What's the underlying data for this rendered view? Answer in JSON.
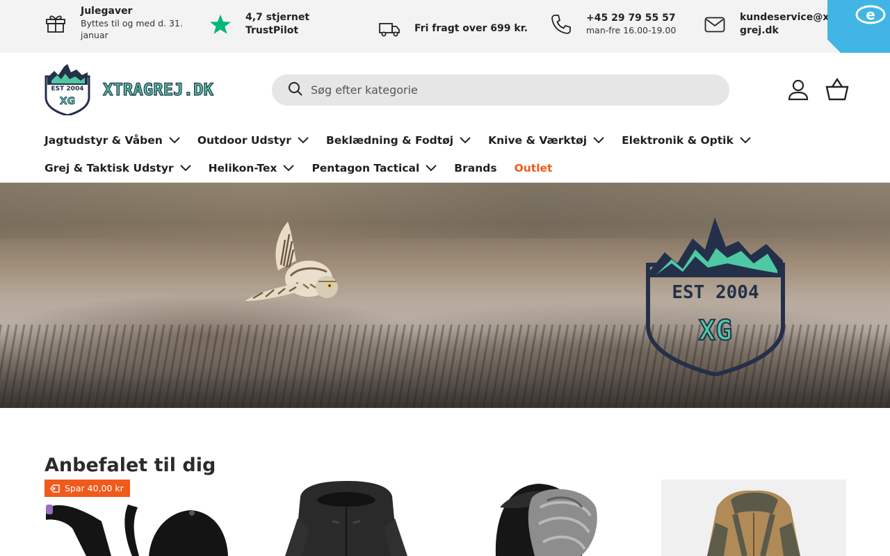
{
  "infobar": {
    "gifts": {
      "title": "Julegaver",
      "subtitle": "Byttes til og med d. 31. januar",
      "icon": "gift-icon"
    },
    "rating": {
      "title": "4,7 stjernet TrustPilot",
      "icon": "star-icon",
      "color": "#00b67a"
    },
    "shipping": {
      "title": "Fri fragt over 699 kr.",
      "icon": "truck-icon"
    },
    "phone": {
      "title": "+45 29 79 55 57",
      "subtitle": "man-fre 16.00-19.00",
      "icon": "phone-icon"
    },
    "email": {
      "title": "kundeservice@xtragrej.dk",
      "icon": "mail-icon"
    },
    "corner_badge": {
      "icon": "e-mark-icon",
      "color": "#41b6e6"
    }
  },
  "header": {
    "logo": {
      "est": "EST 2004",
      "monogram": "XG",
      "wordmark": "XTRAGREJ.DK"
    },
    "search": {
      "placeholder": "Søg efter kategorie"
    },
    "account_icon": "person-icon",
    "cart_icon": "basket-icon"
  },
  "nav": {
    "row1": [
      {
        "label": "Jagtudstyr & Våben",
        "dropdown": true
      },
      {
        "label": "Outdoor Udstyr",
        "dropdown": true
      },
      {
        "label": "Beklædning & Fodtøj",
        "dropdown": true
      },
      {
        "label": "Knive & Værktøj",
        "dropdown": true
      },
      {
        "label": "Elektronik & Optik",
        "dropdown": true
      }
    ],
    "row2": [
      {
        "label": "Grej & Taktisk Udstyr",
        "dropdown": true
      },
      {
        "label": "Helikon-Tex",
        "dropdown": true
      },
      {
        "label": "Pentagon Tactical",
        "dropdown": true
      },
      {
        "label": "Brands",
        "dropdown": false
      },
      {
        "label": "Outlet",
        "dropdown": false,
        "color": "#f05a1a"
      }
    ]
  },
  "hero": {
    "badge": {
      "est": "EST 2004",
      "monogram": "XG"
    },
    "accent_color": "#4fc9a4",
    "navy_color": "#24304a"
  },
  "recommended": {
    "title": "Anbefalet til dig",
    "sale_tag": "Spar 40,00 kr",
    "sale_color": "#f05a1a",
    "products": [
      {
        "image": "backpack-harness"
      },
      {
        "image": "black-jacket"
      },
      {
        "image": "fur-trapper-hat"
      },
      {
        "image": "coyote-jacket"
      }
    ]
  }
}
